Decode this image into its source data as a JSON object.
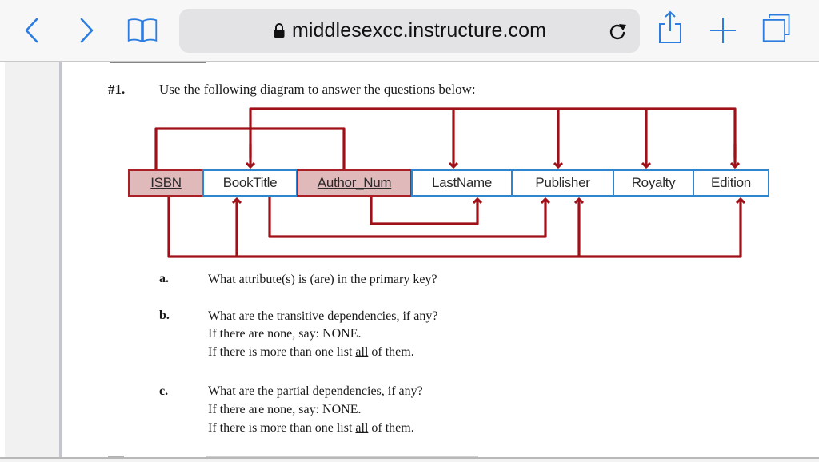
{
  "browser": {
    "url": "middlesexcc.instructure.com",
    "secure": true,
    "icons": {
      "back": "chevron-left-icon",
      "forward": "chevron-right-icon",
      "bookmarks": "open-book-icon",
      "lock": "lock-icon",
      "reload": "reload-icon",
      "share": "share-icon",
      "new_tab": "plus-icon",
      "tabs": "tabs-icon"
    },
    "accent_color": "#2d7de0"
  },
  "document": {
    "question": {
      "number": "#1.",
      "prompt": "Use the following diagram to answer the questions below:"
    },
    "diagram": {
      "attributes": [
        {
          "name": "ISBN",
          "primary_key": true
        },
        {
          "name": "BookTitle",
          "primary_key": false
        },
        {
          "name": "Author_Num",
          "primary_key": true
        },
        {
          "name": "LastName",
          "primary_key": false
        },
        {
          "name": "Publisher",
          "primary_key": false
        },
        {
          "name": "Royalty",
          "primary_key": false
        },
        {
          "name": "Edition",
          "primary_key": false
        }
      ],
      "dependencies": [
        {
          "from": [
            "ISBN",
            "Author_Num"
          ],
          "to": [
            "BookTitle",
            "LastName",
            "Publisher",
            "Royalty",
            "Edition"
          ],
          "kind": "full"
        },
        {
          "from": [
            "Author_Num"
          ],
          "to": [
            "LastName"
          ],
          "kind": "partial"
        },
        {
          "from": [
            "BookTitle"
          ],
          "to": [
            "Publisher"
          ],
          "kind": "transitive"
        },
        {
          "from": [
            "ISBN"
          ],
          "to": [
            "BookTitle",
            "Publisher",
            "Edition"
          ],
          "kind": "partial"
        }
      ],
      "colors": {
        "arrow": "#a01018",
        "key_fill": "#e0b9bb",
        "key_border": "#a92026",
        "nonkey_border": "#2f86cf"
      }
    },
    "items": [
      {
        "label": "a.",
        "lines": [
          "What attribute(s)  is (are) in the primary key?"
        ]
      },
      {
        "label": "b.",
        "lines": [
          "What are the transitive dependencies, if any?",
          "If there are none, say:  NONE.",
          {
            "before": "If there is more than one list ",
            "emphasis": "all",
            "after": " of them."
          }
        ]
      },
      {
        "label": "c.",
        "lines": [
          "What are the partial dependencies, if any?",
          "If there are none, say:  NONE.",
          {
            "before": "If there is more than one list ",
            "emphasis": "all",
            "after": " of them."
          }
        ]
      }
    ]
  }
}
